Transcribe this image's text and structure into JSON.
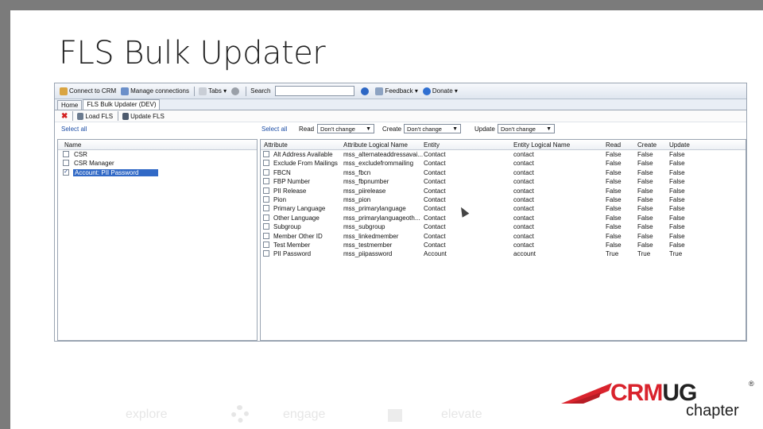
{
  "slide": {
    "title": "FLS Bulk Updater",
    "footer": [
      "explore",
      "engage",
      "elevate"
    ],
    "logo": {
      "crm": "CRM",
      "ug": "UG",
      "reg": "®",
      "chapter": "chapter",
      "crm_color": "#d9232d",
      "ug_color": "#222222"
    }
  },
  "toolbar": {
    "connect": "Connect to CRM",
    "manage": "Manage connections",
    "tabs": "Tabs ▾",
    "search": "Search",
    "feedback": "Feedback ▾",
    "donate": "Donate ▾"
  },
  "tabs": [
    "Home",
    "FLS Bulk Updater (DEV)"
  ],
  "commands": {
    "load": "Load FLS",
    "update": "Update FLS"
  },
  "left": {
    "select_all": "Select all",
    "header": "Name",
    "items": [
      {
        "label": "CSR",
        "checked": false
      },
      {
        "label": "CSR Manager",
        "checked": false
      },
      {
        "label": "Account: PII Password",
        "checked": true
      }
    ]
  },
  "filters": {
    "select_all": "Select all",
    "read_label": "Read",
    "read_value": "Don't change",
    "create_label": "Create",
    "create_value": "Don't change",
    "update_label": "Update",
    "update_value": "Don't change"
  },
  "grid": {
    "headers": [
      "Attribute",
      "Attribute Logical Name",
      "Entity",
      "Entity Logical Name",
      "Read",
      "Create",
      "Update"
    ],
    "rows": [
      [
        "Alt Address Available",
        "mss_alternateaddressavai...",
        "Contact",
        "contact",
        "False",
        "False",
        "False"
      ],
      [
        "Exclude From Mailings",
        "mss_excludefrommailing",
        "Contact",
        "contact",
        "False",
        "False",
        "False"
      ],
      [
        "FBCN",
        "mss_fbcn",
        "Contact",
        "contact",
        "False",
        "False",
        "False"
      ],
      [
        "FBP Number",
        "mss_fbpnumber",
        "Contact",
        "contact",
        "False",
        "False",
        "False"
      ],
      [
        "PII Release",
        "mss_piirelease",
        "Contact",
        "contact",
        "False",
        "False",
        "False"
      ],
      [
        "Pion",
        "mss_pion",
        "Contact",
        "contact",
        "False",
        "False",
        "False"
      ],
      [
        "Primary Language",
        "mss_primarylanguage",
        "Contact",
        "contact",
        "False",
        "False",
        "False"
      ],
      [
        "Other Language",
        "mss_primarylanguageoth...",
        "Contact",
        "contact",
        "False",
        "False",
        "False"
      ],
      [
        "Subgroup",
        "mss_subgroup",
        "Contact",
        "contact",
        "False",
        "False",
        "False"
      ],
      [
        "Member Other ID",
        "mss_linkedmember",
        "Contact",
        "contact",
        "False",
        "False",
        "False"
      ],
      [
        "Test Member",
        "mss_testmember",
        "Contact",
        "contact",
        "False",
        "False",
        "False"
      ],
      [
        "PII Password",
        "mss_piipassword",
        "Account",
        "account",
        "True",
        "True",
        "True"
      ]
    ]
  }
}
